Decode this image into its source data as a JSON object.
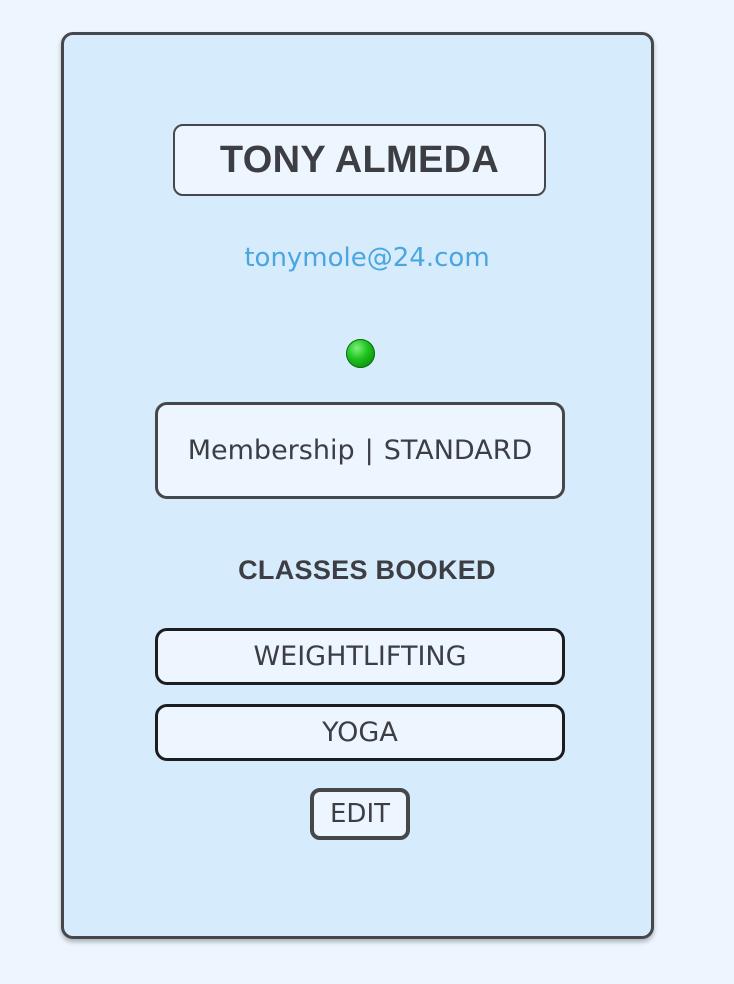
{
  "profile": {
    "name": "TONY ALMEDA",
    "email": "tonymole@24.com",
    "status_color": "#1fc41f"
  },
  "membership": {
    "label": "Membership",
    "separator": "|",
    "tier": "STANDARD"
  },
  "classes": {
    "title": "CLASSES BOOKED",
    "items": [
      {
        "label": "WEIGHTLIFTING"
      },
      {
        "label": "YOGA"
      }
    ]
  },
  "actions": {
    "edit_label": "EDIT"
  }
}
